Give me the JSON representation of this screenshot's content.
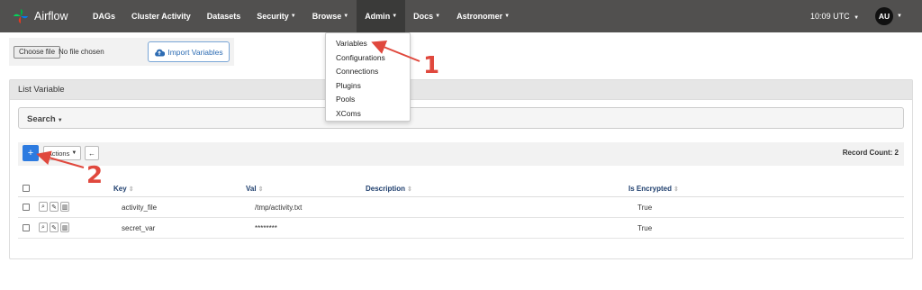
{
  "navbar": {
    "brand": "Airflow",
    "items": [
      {
        "label": "DAGs",
        "caret": false
      },
      {
        "label": "Cluster Activity",
        "caret": false
      },
      {
        "label": "Datasets",
        "caret": false
      },
      {
        "label": "Security",
        "caret": true
      },
      {
        "label": "Browse",
        "caret": true
      },
      {
        "label": "Admin",
        "caret": true,
        "active": true
      },
      {
        "label": "Docs",
        "caret": true
      },
      {
        "label": "Astronomer",
        "caret": true
      }
    ],
    "time": "10:09 UTC",
    "user_initials": "AU"
  },
  "import": {
    "choose_file": "Choose file",
    "no_file": "No file chosen",
    "import_label": "Import Variables"
  },
  "list": {
    "title": "List Variable",
    "search_label": "Search",
    "actions_label": "Actions",
    "record_count": "Record Count: 2",
    "columns": {
      "key": "Key",
      "val": "Val",
      "description": "Description",
      "encrypted": "Is Encrypted"
    },
    "rows": [
      {
        "key": "activity_file",
        "val": "/tmp/activity.txt",
        "description": "",
        "encrypted": "True"
      },
      {
        "key": "secret_var",
        "val": "********",
        "description": "",
        "encrypted": "True"
      }
    ]
  },
  "admin_menu": {
    "items": [
      "Variables",
      "Configurations",
      "Connections",
      "Plugins",
      "Pools",
      "XComs"
    ]
  },
  "annotations": {
    "one": "1",
    "two": "2",
    "color": "#e0483d"
  },
  "colors": {
    "navbar": "#51504f",
    "primary": "#2d7be0",
    "accent_text": "#1f3f6e"
  }
}
